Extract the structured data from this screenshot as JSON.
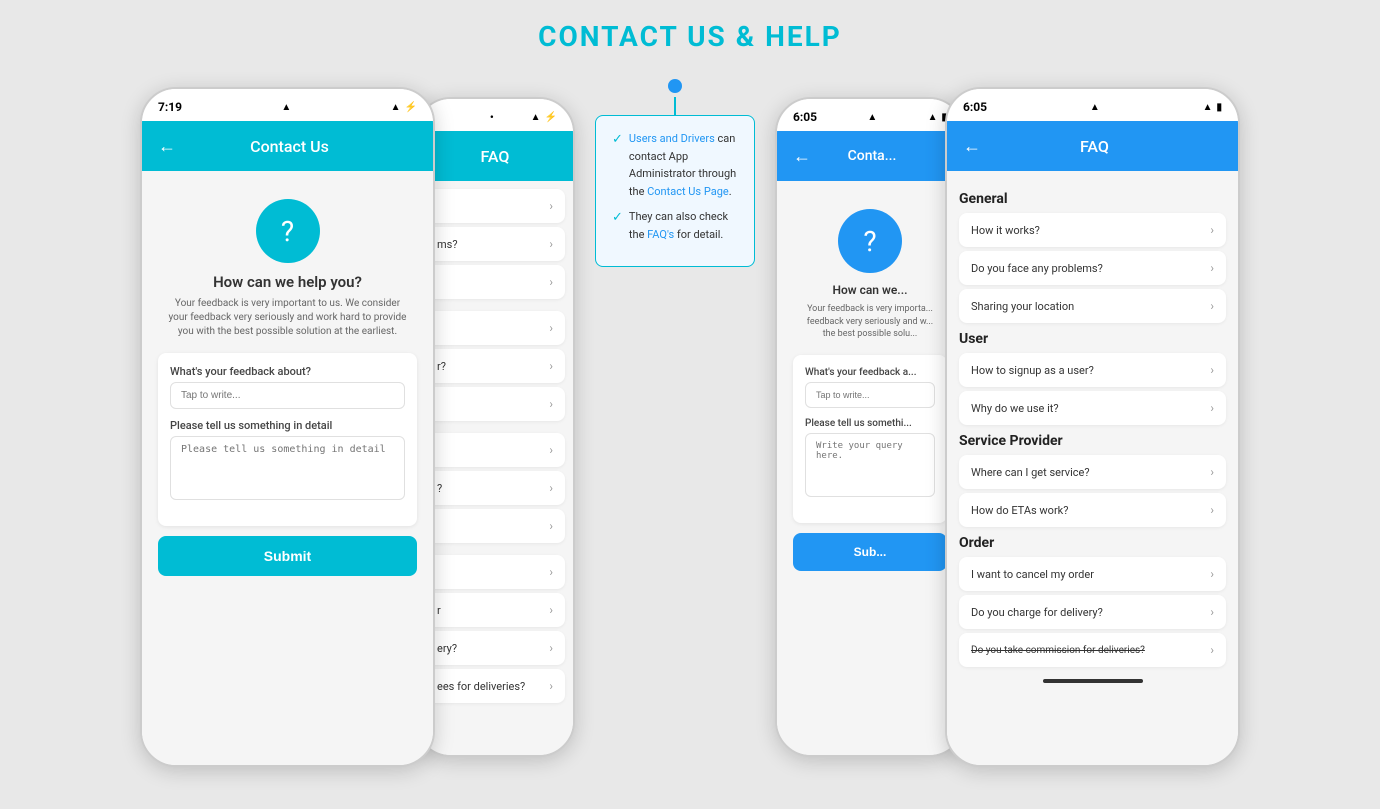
{
  "page": {
    "title": "CONTACT US & HELP"
  },
  "phone1": {
    "status": {
      "time": "7:19",
      "arrow": "▲",
      "wifi": "WiFi",
      "battery": "⚡"
    },
    "header": {
      "back": "←",
      "title": "Contact Us",
      "color": "teal"
    },
    "contact": {
      "icon": "?",
      "title": "How can we help you?",
      "subtitle": "Your feedback is very important to us. We consider your feedback very seriously and work hard to provide you with the best possible solution at the earliest.",
      "feedbackLabel": "What's your feedback about?",
      "feedbackPlaceholder": "Tap to write...",
      "detailLabel": "Please tell us something in detail",
      "detailPlaceholder": "Please tell us something in detail",
      "submitBtn": "Submit"
    }
  },
  "phone2": {
    "status": {
      "time": "•",
      "wifi": "WiFi",
      "battery": "⚡"
    },
    "header": {
      "back": "←",
      "title": "FAQ",
      "color": "teal"
    },
    "faq_items": [
      {
        "label": ""
      },
      {
        "label": "ms?"
      },
      {
        "label": ""
      },
      {
        "label": ""
      },
      {
        "label": "r?"
      },
      {
        "label": ""
      },
      {
        "label": ""
      },
      {
        "label": "?"
      },
      {
        "label": ""
      },
      {
        "label": ""
      },
      {
        "label": "r"
      },
      {
        "label": "ery?"
      },
      {
        "label": "ees for deliveries?"
      }
    ]
  },
  "callout": {
    "line1_check": "✓",
    "line1_text_plain": "Users and Drivers can contact App Administrator through the ",
    "line1_link": "Contact Us Page",
    "line2_check": "✓",
    "line2_text_plain": "They can also check the ",
    "line2_link": "FAQ's",
    "line2_text_end": " for detail."
  },
  "phone3": {
    "status": {
      "time": "6:05",
      "arrow": "▲",
      "wifi": "WiFi",
      "battery": "▮"
    },
    "header": {
      "back": "←",
      "title": "Conta...",
      "color": "blue"
    },
    "contact": {
      "icon": "?",
      "title": "How can we...",
      "subtitle": "Your feedback is very importa... feedback very seriously and w... the best possible solu...",
      "feedbackLabel": "What's your feedback a...",
      "feedbackPlaceholder": "Tap to write...",
      "detailLabel": "Please tell us somethi...",
      "detailPlaceholder": "Write your query here.",
      "submitBtn": "Sub..."
    }
  },
  "phone4": {
    "status": {
      "time": "6:05",
      "arrow": "▲",
      "wifi": "WiFi",
      "battery": "▮"
    },
    "header": {
      "back": "←",
      "title": "FAQ",
      "color": "blue"
    },
    "sections": [
      {
        "title": "General",
        "items": [
          {
            "label": "How it works?"
          },
          {
            "label": "Do you face any problems?"
          },
          {
            "label": "Sharing your location"
          }
        ]
      },
      {
        "title": "User",
        "items": [
          {
            "label": "How to signup as a user?"
          },
          {
            "label": "Why do we use it?"
          }
        ]
      },
      {
        "title": "Service Provider",
        "items": [
          {
            "label": "Where can I get service?"
          },
          {
            "label": "How do ETAs work?"
          }
        ]
      },
      {
        "title": "Order",
        "items": [
          {
            "label": "I want to cancel my order"
          },
          {
            "label": "Do you charge for delivery?"
          },
          {
            "label": "Do you take commission for deliveries?"
          }
        ]
      }
    ]
  }
}
